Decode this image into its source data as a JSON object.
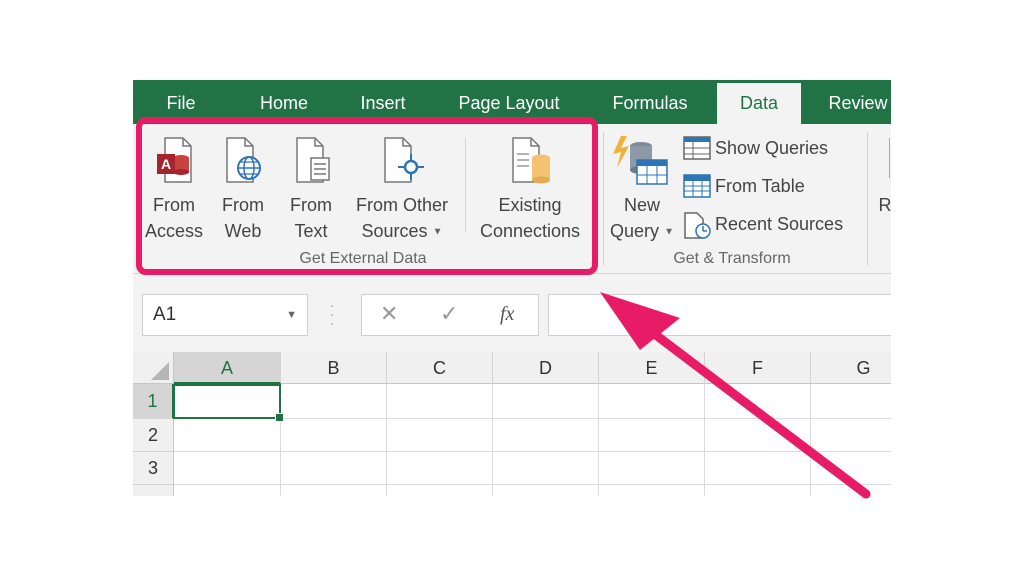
{
  "tabs": [
    "File",
    "Home",
    "Insert",
    "Page Layout",
    "Formulas",
    "Data",
    "Review"
  ],
  "active_tab": "Data",
  "get_external_data": {
    "group_label": "Get External Data",
    "buttons": {
      "from_access": [
        "From",
        "Access"
      ],
      "from_web": [
        "From",
        "Web"
      ],
      "from_text": [
        "From",
        "Text"
      ],
      "from_other": [
        "From Other",
        "Sources"
      ],
      "existing": [
        "Existing",
        "Connections"
      ]
    }
  },
  "get_transform": {
    "group_label": "Get & Transform",
    "new_query": [
      "New",
      "Query"
    ],
    "show_queries": "Show Queries",
    "from_table": "From Table",
    "recent_sources": "Recent Sources"
  },
  "next_group_fragment": "R",
  "formula_bar": {
    "name_box": "A1",
    "cancel_symbol": "✕",
    "enter_symbol": "✓",
    "fx_label": "fx",
    "value": ""
  },
  "sheet": {
    "columns": [
      "A",
      "B",
      "C",
      "D",
      "E",
      "F",
      "G"
    ],
    "rows": [
      "1",
      "2",
      "3"
    ],
    "selected_cell": "A1"
  },
  "colors": {
    "excel_green": "#217346",
    "highlight": "#e81c66"
  },
  "icons": {
    "from_access": "access-file-icon",
    "from_web": "web-file-icon",
    "from_text": "text-file-icon",
    "from_other": "other-sources-icon",
    "existing": "existing-connections-icon",
    "new_query": "new-query-icon",
    "show_queries": "show-queries-icon",
    "from_table": "from-table-icon",
    "recent_sources": "recent-sources-icon"
  }
}
